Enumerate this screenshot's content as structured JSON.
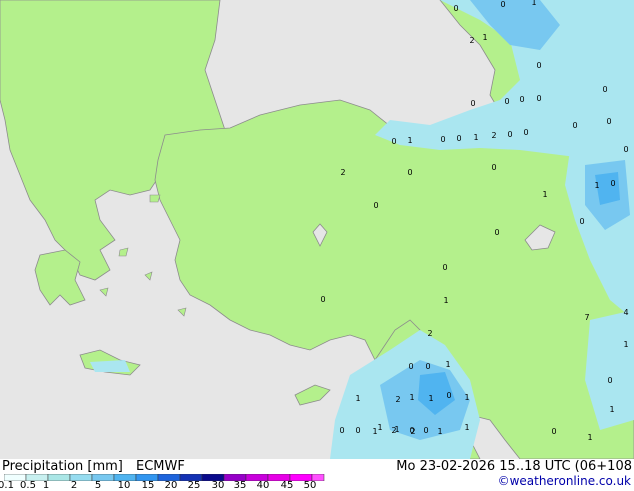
{
  "legend": {
    "title": "Precipitation [mm]",
    "model": "ECMWF",
    "datetime": "Mo 23-02-2026 15..18 UTC (06+108",
    "credit": "©weatheronline.co.uk",
    "ticks": [
      "0.1",
      "0.5",
      "1",
      "2",
      "5",
      "10",
      "15",
      "20",
      "25",
      "30",
      "35",
      "40",
      "45",
      "50"
    ],
    "colors": [
      "#f0ffff",
      "#c8f0f0",
      "#aae6e6",
      "#96dcf0",
      "#78c8f0",
      "#50b4f0",
      "#3296f0",
      "#1e64dc",
      "#1432b4",
      "#0a0a8c",
      "#9600c8",
      "#c800dc",
      "#e600e6",
      "#ff00ff",
      "#ff50ff"
    ]
  },
  "map": {
    "land_color": "#b4f08c",
    "sea_color": "#e6e6e6",
    "coast_color": "#8c8c8c",
    "precip_light": "#aae6f0",
    "precip_mid": "#78c8f0",
    "precip_heavy": "#50b4f0",
    "precip_values": [
      "0",
      "1",
      "2",
      "1",
      "0",
      "0",
      "0",
      "0",
      "0",
      "0",
      "0",
      "0",
      "0",
      "0",
      "1",
      "0",
      "0",
      "1",
      "2",
      "0",
      "0",
      "0",
      "2",
      "0",
      "0",
      "1",
      "1",
      "0",
      "0",
      "0",
      "0",
      "0",
      "0",
      "1",
      "2",
      "7",
      "4",
      "1",
      "0",
      "0",
      "1",
      "1",
      "0",
      "1",
      "1",
      "2",
      "1",
      "0",
      "0",
      "1",
      "2",
      "2",
      "1",
      "0",
      "1",
      "0",
      "1",
      "1",
      "1",
      "0",
      "0",
      "1"
    ]
  }
}
